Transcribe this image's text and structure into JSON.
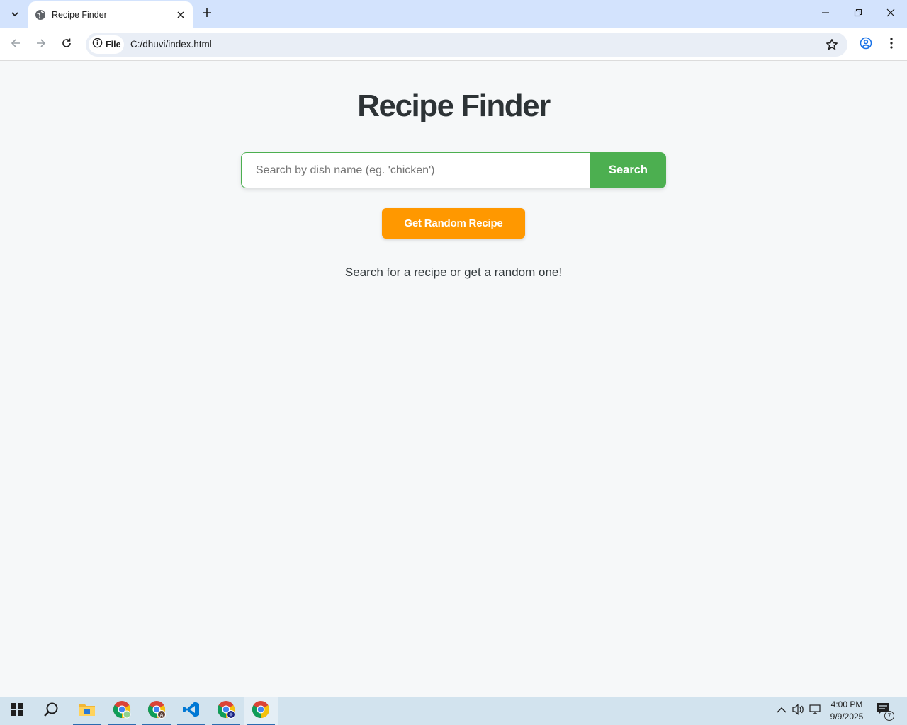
{
  "browser": {
    "tab_title": "Recipe Finder",
    "chip_label": "File",
    "url": "C:/dhuvi/index.html"
  },
  "page": {
    "title": "Recipe Finder",
    "search_placeholder": "Search by dish name (eg. 'chicken')",
    "search_value": "",
    "search_button": "Search",
    "random_button": "Get Random Recipe",
    "status_text": "Search for a recipe or get a random one!"
  },
  "colors": {
    "search_green": "#4caf50",
    "random_orange": "#ff9800",
    "page_bg": "#f6f8f9",
    "tabstrip_bg": "#d3e3fd"
  },
  "taskbar": {
    "apps": [
      "windows-start-icon",
      "search-icon",
      "file-explorer-icon",
      "chrome-icon",
      "chrome-profile-a-icon",
      "vscode-icon",
      "chrome-profile-icon",
      "chrome-icon"
    ],
    "time": "4:00 PM",
    "date": "9/9/2025",
    "notification_count": "7"
  }
}
